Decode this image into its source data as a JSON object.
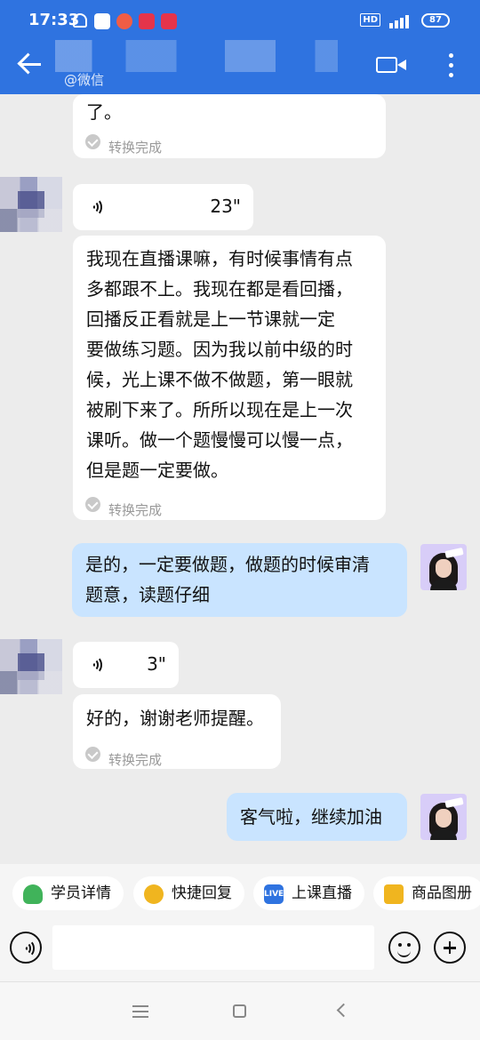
{
  "status": {
    "time": "17:33",
    "network": "HD",
    "signal": "4G",
    "battery": "87"
  },
  "header": {
    "contact_source": "@微信"
  },
  "messages": [
    {
      "sender": "contact",
      "transcript": "了。",
      "status": "转换完成"
    },
    {
      "sender": "contact",
      "voice_duration": "23\"",
      "transcript": "我现在直播课嘛，有时候事情有点\n多都跟不上。我现在都是看回播，\n回播反正看就是上一节课就一定\n要做练习题。因为我以前中级的时\n候，光上课不做不做题，第一眼就\n被刷下来了。所所以现在是上一次\n课听。做一个题慢慢可以慢一点，\n但是题一定要做。",
      "status": "转换完成"
    },
    {
      "sender": "me",
      "text": "是的，一定要做题，做题的时候审清\n题意，读题仔细"
    },
    {
      "sender": "contact",
      "voice_duration": "3\"",
      "transcript": "好的，谢谢老师提醒。",
      "status": "转换完成"
    },
    {
      "sender": "me",
      "text": "客气啦，继续加油"
    }
  ],
  "quick_actions": [
    {
      "label": "学员详情",
      "icon": "student-detail-icon"
    },
    {
      "label": "快捷回复",
      "icon": "quick-reply-icon"
    },
    {
      "label": "上课直播",
      "icon": "live-icon",
      "icon_text": "LIVE"
    },
    {
      "label": "商品图册",
      "icon": "product-album-icon"
    }
  ],
  "input": {
    "placeholder": ""
  },
  "colors": {
    "header": "#2f73e0",
    "my_bubble": "#c9e4ff",
    "contact_bubble": "#ffffff",
    "background": "#ececec"
  }
}
